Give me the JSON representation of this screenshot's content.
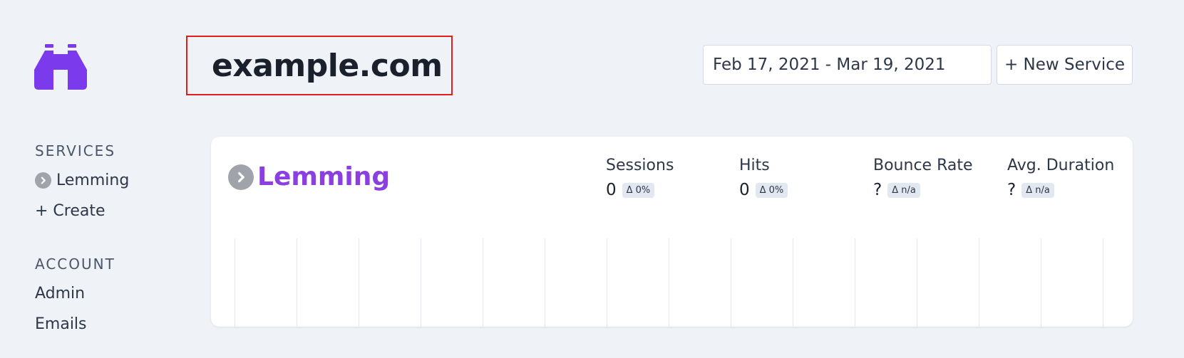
{
  "app": {
    "site_title": "example.com",
    "brand_color": "#8b3fe0",
    "logo_icon": "binoculars-icon"
  },
  "header": {
    "date_range": "Feb 17, 2021 - Mar 19, 2021",
    "new_service_label": "+ New Service"
  },
  "sidebar": {
    "services_heading": "SERVICES",
    "services": [
      {
        "label": "Lemming",
        "icon": "chevron-right-icon"
      },
      {
        "label": "+ Create"
      }
    ],
    "account_heading": "ACCOUNT",
    "account": [
      {
        "label": "Admin"
      },
      {
        "label": "Emails"
      }
    ]
  },
  "service_card": {
    "name": "Lemming",
    "stats": [
      {
        "label": "Sessions",
        "value": "0",
        "delta": "Δ 0%"
      },
      {
        "label": "Hits",
        "value": "0",
        "delta": "Δ 0%"
      },
      {
        "label": "Bounce Rate",
        "value": "?",
        "delta": "Δ n/a"
      },
      {
        "label": "Avg. Duration",
        "value": "?",
        "delta": "Δ n/a"
      }
    ]
  }
}
